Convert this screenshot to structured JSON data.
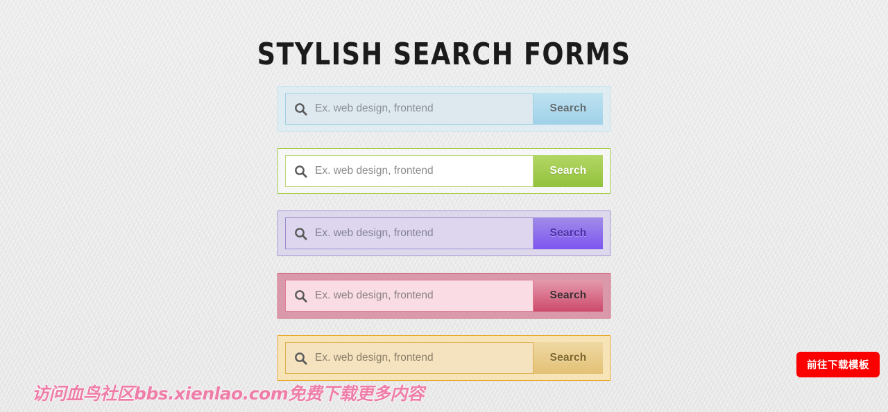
{
  "page": {
    "title": "STYLISH SEARCH FORMS",
    "background_color": "#eaeaea"
  },
  "search_icon_name": "search-icon",
  "forms": [
    {
      "theme": "blue",
      "placeholder": "Ex. web design, frontend",
      "value": "",
      "button_label": "Search",
      "border_color": "#bfe2f0",
      "field_bg": "#dde9ef",
      "button_bg": "#9fd1e8",
      "button_text_color": "#5d6b73"
    },
    {
      "theme": "green",
      "placeholder": "Ex. web design, frontend",
      "value": "",
      "button_label": "Search",
      "border_color": "#a2ce44",
      "field_bg": "#ffffff",
      "button_bg": "#93c13d",
      "button_text_color": "#ffffff"
    },
    {
      "theme": "purple",
      "placeholder": "Ex. web design, frontend",
      "value": "",
      "button_label": "Search",
      "border_color": "#a292d4",
      "field_bg": "#ddd6ee",
      "button_bg": "#7d55f0",
      "button_text_color": "#4b2ea6"
    },
    {
      "theme": "pink",
      "placeholder": "Ex. web design, frontend",
      "value": "",
      "button_label": "Search",
      "border_color": "#c9566f",
      "field_bg": "#fadde4",
      "button_bg": "#cd4a6b",
      "button_text_color": "#3b2b30"
    },
    {
      "theme": "yellow",
      "placeholder": "Ex. web design, frontend",
      "value": "",
      "button_label": "Search",
      "border_color": "#e8a92b",
      "field_bg": "#f5e3c0",
      "button_bg": "#e3c175",
      "button_text_color": "#7b6427"
    }
  ],
  "watermark": {
    "text": "访问血鸟社区bbs.xienlao.com免费下载更多内容",
    "color": "#ef6fa0"
  },
  "download_cta": {
    "label": "前往下载模板",
    "color": "#fa0000"
  }
}
